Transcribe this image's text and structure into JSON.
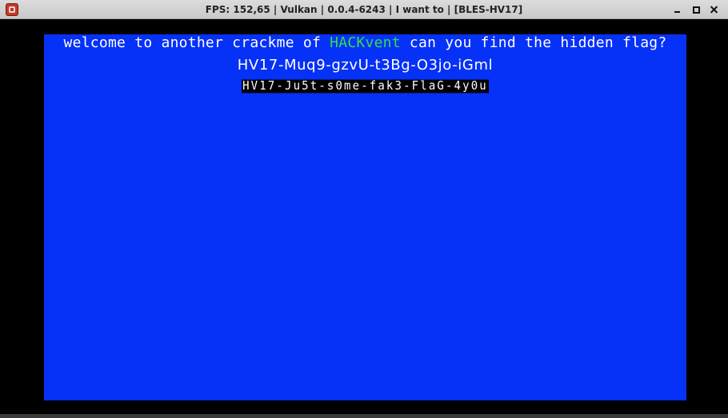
{
  "window": {
    "title": "FPS: 152,65 | Vulkan | 0.0.4-6243 | I want to  | [BLES-HV17]"
  },
  "screen": {
    "welcome_before": "welcome to another crackme of ",
    "welcome_highlight": "HACKvent",
    "welcome_after": " can you find the hidden flag?",
    "flag": "HV17-Muq9-gzvU-t3Bg-O3jo-iGml",
    "fake_flag": "HV17-Ju5t-s0me-fak3-FlaG-4y0u"
  },
  "colors": {
    "screen_background": "#0631f6",
    "highlight": "#30e04a",
    "text": "#ffffff"
  },
  "icons": {
    "app": "rpcs3-icon",
    "minimize": "minimize-icon",
    "maximize": "maximize-icon",
    "close": "close-icon"
  }
}
